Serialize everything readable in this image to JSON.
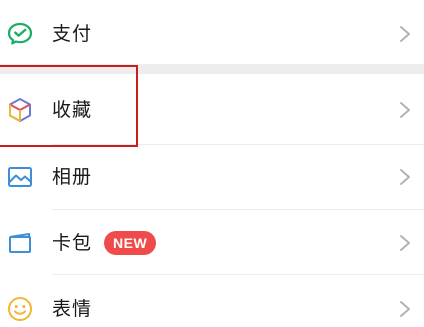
{
  "menu": {
    "pay": {
      "label": "支付",
      "icon": "wechat-pay-icon"
    },
    "favorites": {
      "label": "收藏",
      "icon": "cube-icon"
    },
    "album": {
      "label": "相册",
      "icon": "picture-icon"
    },
    "cards": {
      "label": "卡包",
      "icon": "card-icon",
      "badge": "NEW"
    },
    "stickers": {
      "label": "表情",
      "icon": "smiley-icon"
    }
  },
  "colors": {
    "badge": "#f04b4b",
    "highlight": "#c81e1e",
    "pay_icon": "#1aad66",
    "album_icon": "#3b8fd8",
    "card_icon": "#3b8fd8",
    "smiley_icon": "#f2b534"
  }
}
